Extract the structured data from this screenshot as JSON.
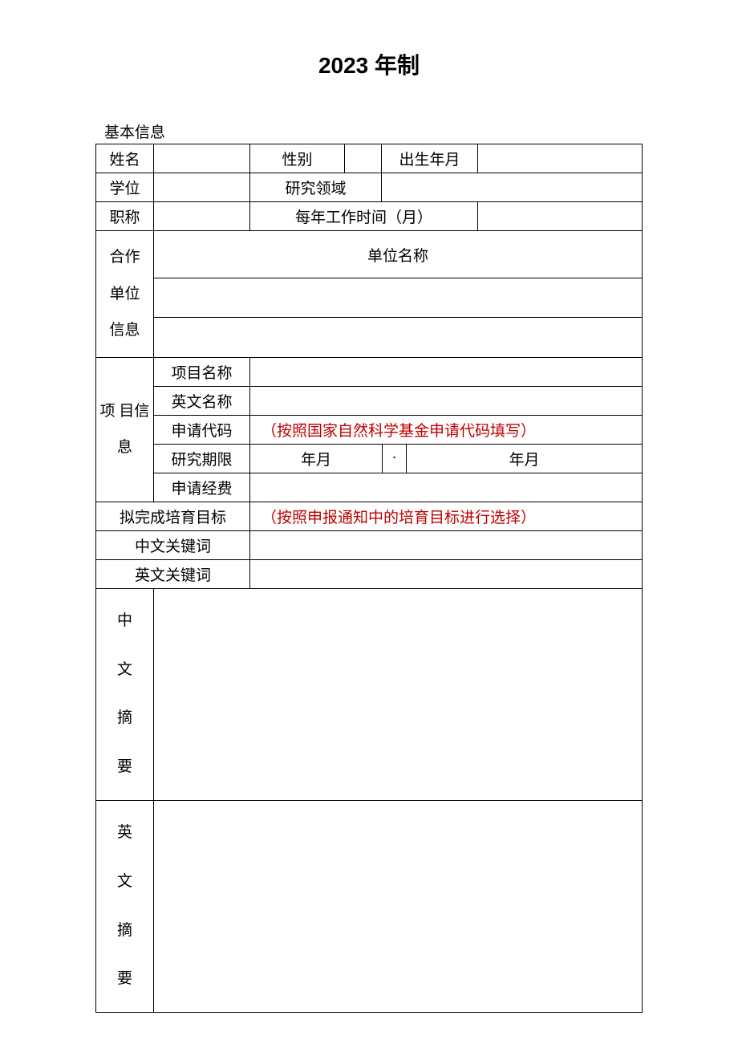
{
  "page": {
    "title": "2023 年制",
    "section": "基本信息"
  },
  "labels": {
    "name": "姓名",
    "gender": "性别",
    "birth": "出生年月",
    "degree": "学位",
    "field": "研究领域",
    "title": "职称",
    "work_months": "每年工作时间（月）",
    "partner_unit_info": "合作单位信息",
    "unit_name": "单位名称",
    "project_info": "项 目信息",
    "proj_name": "项目名称",
    "proj_name_en": "英文名称",
    "app_code": "申请代码",
    "period": "研究期限",
    "funds": "申请经费",
    "goal": "拟完成培育目标",
    "kw_cn": "中文关键词",
    "kw_en": "英文关键词",
    "abs_cn": "中文摘要",
    "abs_en": "英文摘要"
  },
  "hints": {
    "app_code": "（按照国家自然科学基金申请代码填写）",
    "period_from": "年月",
    "period_sep": "·",
    "period_to": "年月",
    "goal": "（按照申报通知中的培育目标进行选择）"
  }
}
